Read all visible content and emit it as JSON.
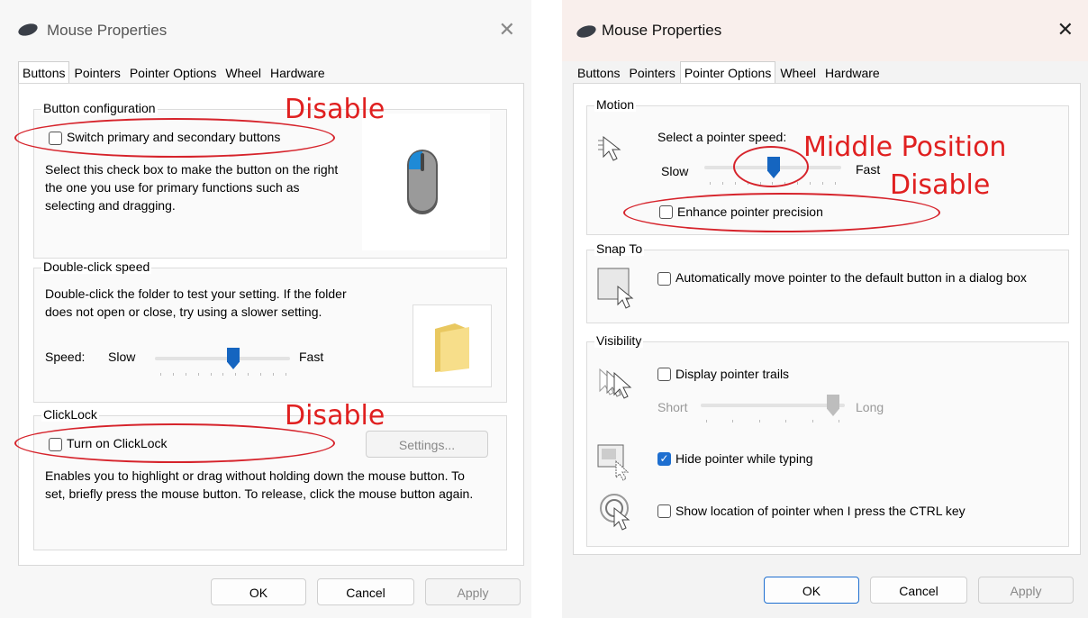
{
  "left": {
    "title": "Mouse Properties",
    "tabs": [
      "Buttons",
      "Pointers",
      "Pointer Options",
      "Wheel",
      "Hardware"
    ],
    "button_config": {
      "legend": "Button configuration",
      "checkbox_label": "Switch primary and secondary buttons",
      "checked": false,
      "description": "Select this check box to make the button on the right the one you use for primary functions such as selecting and dragging."
    },
    "double_click": {
      "legend": "Double-click speed",
      "description": "Double-click the folder to test your setting. If the folder does not open or close, try using a slower setting.",
      "speed_label": "Speed:",
      "slow": "Slow",
      "fast": "Fast",
      "value_fraction": 0.6
    },
    "clicklock": {
      "legend": "ClickLock",
      "checkbox_label": "Turn on ClickLock",
      "checked": false,
      "settings_button": "Settings...",
      "description": "Enables you to highlight or drag without holding down the mouse button. To set, briefly press the mouse button. To release, click the mouse button again."
    },
    "buttons": {
      "ok": "OK",
      "cancel": "Cancel",
      "apply": "Apply"
    },
    "annotations": {
      "disable_1": "Disable",
      "disable_2": "Disable"
    }
  },
  "right": {
    "title": "Mouse Properties",
    "tabs": [
      "Buttons",
      "Pointers",
      "Pointer Options",
      "Wheel",
      "Hardware"
    ],
    "motion": {
      "legend": "Motion",
      "select_speed": "Select a pointer speed:",
      "slow": "Slow",
      "fast": "Fast",
      "value_fraction": 0.5,
      "enhance_label": "Enhance pointer precision",
      "enhance_checked": false
    },
    "snap_to": {
      "legend": "Snap To",
      "checkbox_label": "Automatically move pointer to the default button in a dialog box",
      "checked": false
    },
    "visibility": {
      "legend": "Visibility",
      "trails_label": "Display pointer trails",
      "trails_checked": false,
      "short": "Short",
      "long": "Long",
      "hide_label": "Hide pointer while typing",
      "hide_checked": true,
      "show_location_label": "Show location of pointer when I press the CTRL key",
      "show_location_checked": false
    },
    "buttons": {
      "ok": "OK",
      "cancel": "Cancel",
      "apply": "Apply"
    },
    "annotations": {
      "middle": "Middle Position",
      "disable": "Disable"
    }
  },
  "colors": {
    "accent": "#1e6fd0",
    "annotation": "#e02020"
  }
}
